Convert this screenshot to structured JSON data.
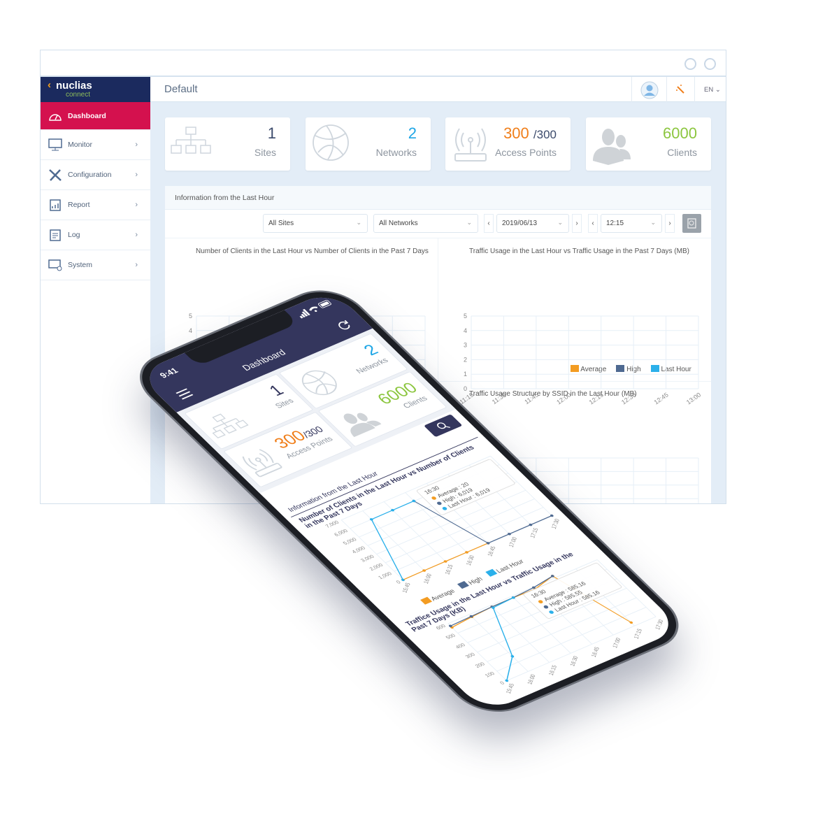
{
  "header": {
    "title": "Default",
    "language": "EN"
  },
  "logo": {
    "brand": "nuclias",
    "sub": "connect"
  },
  "sidebar": {
    "items": [
      {
        "label": "Dashboard",
        "icon": "speedometer-icon",
        "active": true
      },
      {
        "label": "Monitor",
        "icon": "monitor-icon"
      },
      {
        "label": "Configuration",
        "icon": "tools-icon"
      },
      {
        "label": "Report",
        "icon": "report-icon"
      },
      {
        "label": "Log",
        "icon": "log-icon"
      },
      {
        "label": "System",
        "icon": "system-icon"
      }
    ]
  },
  "cards": [
    {
      "value": "1",
      "label": "Sites",
      "color": "#3b4a6b",
      "icon": "sitemap-icon"
    },
    {
      "value": "2",
      "label": "Networks",
      "color": "#1ea6e6",
      "icon": "globe-icon"
    },
    {
      "value": "300",
      "suffix": "/300",
      "label": "Access Points",
      "color": "#f07f1b",
      "icon": "access-point-icon"
    },
    {
      "value": "6000",
      "label": "Clients",
      "color": "#8cc63f",
      "icon": "users-icon"
    }
  ],
  "panel": {
    "title": "Information from the Last Hour",
    "filters": {
      "site": "All Sites",
      "network": "All Networks",
      "date": "2019/06/13",
      "time": "12:15"
    }
  },
  "legend": [
    "Average",
    "High",
    "Last Hour"
  ],
  "colors": {
    "average": "#f39c22",
    "high": "#4f6a91",
    "last_hour": "#2bb0ea",
    "navy": "#34365d",
    "sidebar_active": "#d4114e"
  },
  "phone": {
    "time": "9:41",
    "title": "Dashboard",
    "info_title": "Information from the Last Hour"
  },
  "chart_data": [
    {
      "type": "line",
      "title": "Number of Clients in the Last Hour vs Number of Clients in the Past 7 Days",
      "x": [
        "11:15",
        "11:30",
        "11:45",
        "12:00",
        "12:15",
        "12:30",
        "12:45",
        "13:00"
      ],
      "ylim": [
        0,
        5
      ],
      "yticks": [
        "0",
        "1",
        "2",
        "3",
        "4",
        "5"
      ],
      "series": [],
      "grid": true
    },
    {
      "type": "line",
      "title": "Traffic Usage in the Last Hour vs Traffic Usage in the Past 7 Days (MB)",
      "x": [
        "11:15",
        "11:30",
        "11:45",
        "12:00",
        "12:15",
        "12:30",
        "12:45",
        "13:00"
      ],
      "ylim": [
        0,
        5
      ],
      "yticks": [
        "0",
        "1",
        "2",
        "3",
        "4",
        "5"
      ],
      "series": [],
      "legend": "bottom-right",
      "grid": true
    },
    {
      "type": "line",
      "title": "Traffic Usage Structure by SSID in the Last Hour (MB)",
      "series": [],
      "grid": true
    },
    {
      "type": "line",
      "title": "Number of Clients in the Last Hour vs Number of Clients in the Past 7 Days",
      "x": [
        "15:45",
        "16:00",
        "16:15",
        "16:30",
        "16:45",
        "17:00",
        "17:15",
        "17:30"
      ],
      "ylim": [
        0,
        7000
      ],
      "yticks": [
        "0",
        "1,000",
        "2,000",
        "3,000",
        "4,000",
        "5,000",
        "6,000",
        "7,000"
      ],
      "series": [
        {
          "name": "Average",
          "values": [
            0,
            20,
            20,
            20,
            20,
            null,
            null,
            null
          ]
        },
        {
          "name": "High",
          "values": [
            null,
            null,
            null,
            6019,
            20,
            25,
            30,
            35
          ]
        },
        {
          "name": "Last Hour",
          "values": [
            0,
            6000,
            6010,
            6019,
            null,
            null,
            null,
            null
          ]
        }
      ],
      "tooltip": {
        "x": "16:30",
        "lines": [
          "Average : 20",
          "High : 6,019",
          "Last Hour : 6,019"
        ]
      },
      "legend": "bottom",
      "grid": true
    },
    {
      "type": "line",
      "title": "Traffice Usage in the Last Hour vs Traffic Usage in the Past 7 Days (KB)",
      "x": [
        "15:45",
        "16:00",
        "16:15",
        "16:30",
        "16:45",
        "17:00",
        "17:15",
        "17:30"
      ],
      "ylim": [
        0,
        600
      ],
      "yticks": [
        "0",
        "100",
        "200",
        "300",
        "400",
        "500",
        "600"
      ],
      "series": [
        {
          "name": "Average",
          "values": [
            560,
            575,
            585,
            585.16,
            580,
            620,
            35,
            null
          ]
        },
        {
          "name": "High",
          "values": [
            575,
            580,
            585,
            585.55,
            595,
            620,
            null,
            null
          ]
        },
        {
          "name": "Last Hour",
          "values": [
            0,
            160,
            575,
            585.16,
            null,
            null,
            null,
            null
          ]
        }
      ],
      "tooltip": {
        "x": "16:30",
        "lines": [
          "Average : 585.16",
          "High : 585.55",
          "Last Hour : 585.16"
        ]
      },
      "grid": true
    }
  ]
}
